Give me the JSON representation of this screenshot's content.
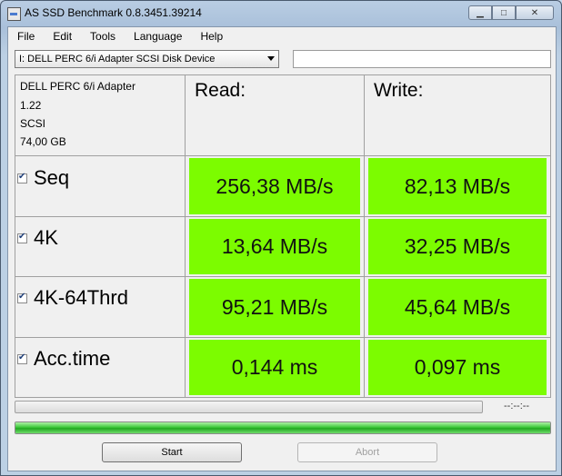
{
  "window": {
    "title": "AS SSD Benchmark 0.8.3451.39214"
  },
  "caption": {
    "minimize": "▁",
    "maximize": "□",
    "close": "✕"
  },
  "menu": [
    "File",
    "Edit",
    "Tools",
    "Language",
    "Help"
  ],
  "device_select": {
    "value": "I: DELL PERC 6/i Adapter SCSI Disk Device"
  },
  "device_info": {
    "name": "DELL PERC 6/i Adapter",
    "firmware": "1.22",
    "interface": "SCSI",
    "size": "74,00 GB"
  },
  "columns": {
    "read": "Read:",
    "write": "Write:"
  },
  "rows": [
    {
      "label": "Seq",
      "read": "256,38 MB/s",
      "write": "82,13 MB/s"
    },
    {
      "label": "4K",
      "read": "13,64 MB/s",
      "write": "32,25 MB/s"
    },
    {
      "label": "4K-64Thrd",
      "read": "95,21 MB/s",
      "write": "45,64 MB/s"
    },
    {
      "label": "Acc.time",
      "read": "0,144 ms",
      "write": "0,097 ms"
    }
  ],
  "progress": {
    "elapsed": "--:--:--",
    "total_fraction": 1.0
  },
  "buttons": {
    "start": "Start",
    "abort": "Abort"
  },
  "colors": {
    "result_cell": "#7cfc00",
    "progress": "#22a822"
  }
}
